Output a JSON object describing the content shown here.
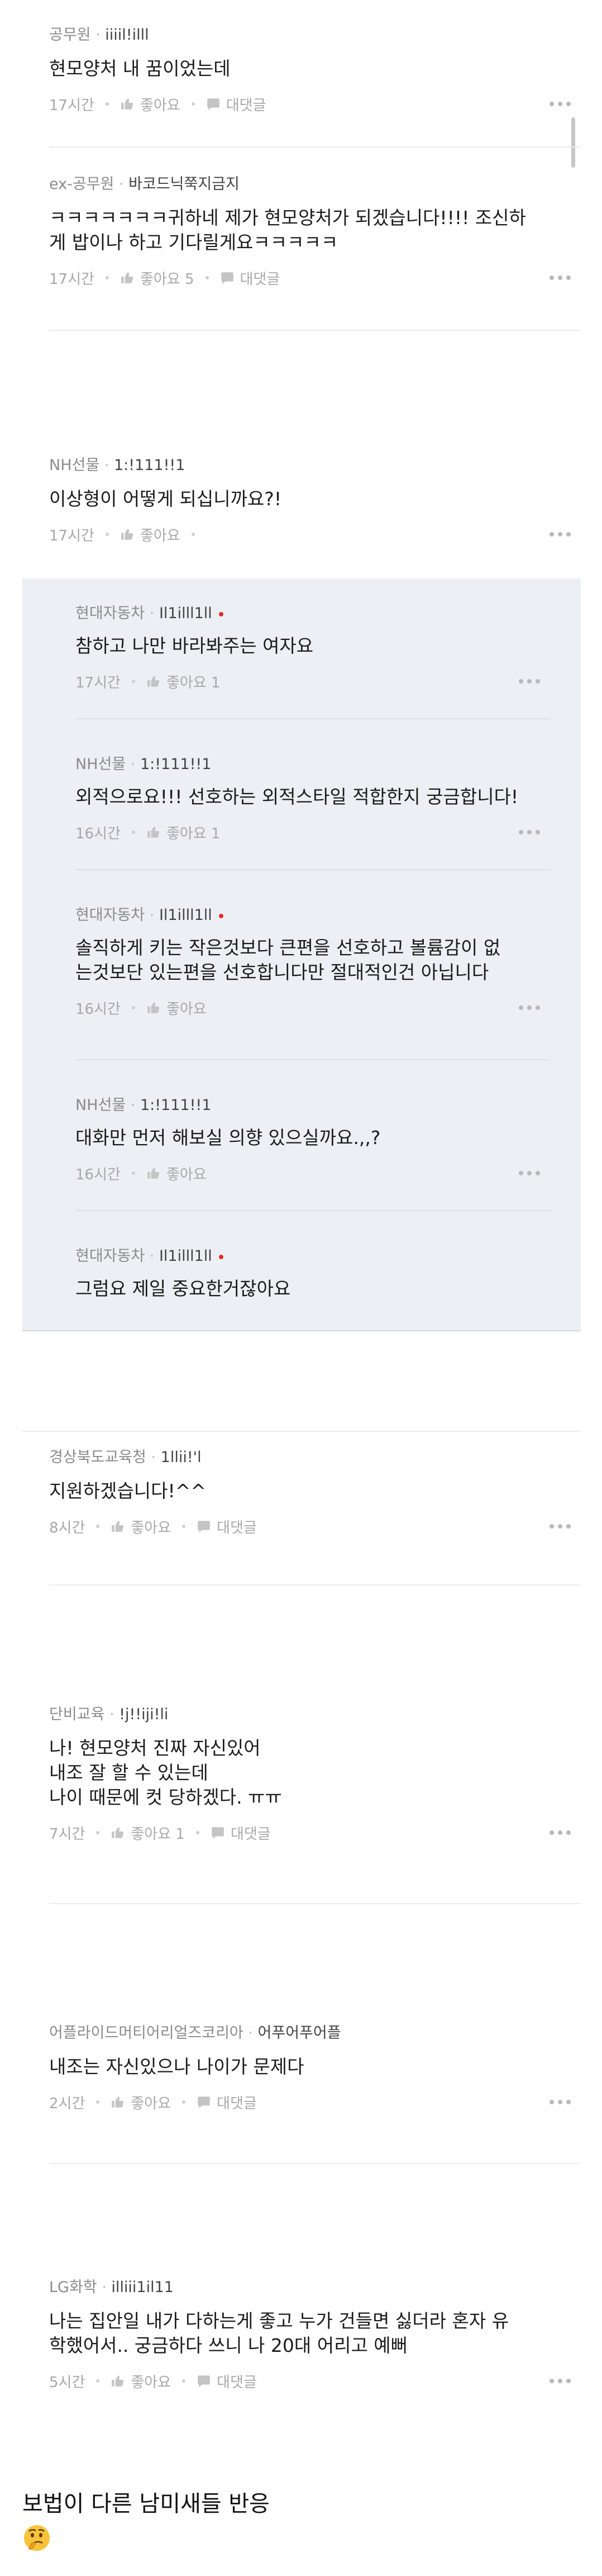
{
  "labels": {
    "like": "좋아요",
    "reply": "대댓글"
  },
  "comments": [
    {
      "company": "공무원",
      "nick": "iiiil!illl",
      "text": "현모양처 내 꿈이었는데",
      "time": "17시간",
      "like": "좋아요",
      "reply": "대댓글"
    },
    {
      "company": "ex-공무원",
      "nick": "바코드닉쭉지금지",
      "text": "ㅋㅋㅋㅋㅋㅋㅋ귀하네 제가 현모양처가 되겠습니다!!!! 조신하\n게 밥이나 하고 기다릴게요ㅋㅋㅋㅋㅋ",
      "time": "17시간",
      "like": "좋아요 5",
      "reply": "대댓글"
    },
    {
      "company": "NH선물",
      "nick": "1:!111!!1",
      "text": "이상형이 어떻게 되십니까요?!",
      "time": "17시간",
      "like": "좋아요"
    },
    {
      "company": "경상북도교육청",
      "nick": "1llii!'l",
      "text": "지원하겠습니다!^^",
      "time": "8시간",
      "like": "좋아요",
      "reply": "대댓글"
    },
    {
      "company": "단비교육",
      "nick": "!j!!iji!li",
      "text": "나! 현모양처 진짜 자신있어\n내조 잘 할 수 있는데\n나이 때문에 컷 당하겠다. ㅠㅠ",
      "time": "7시간",
      "like": "좋아요 1",
      "reply": "대댓글"
    },
    {
      "company": "어플라이드머티어리얼즈코리아",
      "nick": "어푸어푸어플",
      "text": "내조는 자신있으나 나이가 문제다",
      "time": "2시간",
      "like": "좋아요",
      "reply": "대댓글"
    },
    {
      "company": "LG화학",
      "nick": "illiii1il11",
      "text": "나는 집안일 내가 다하는게 좋고 누가 건들면 싫더라 혼자 유\n학했어서.. 궁금하다 쓰니 나 20대 어리고 예뻐",
      "time": "5시간",
      "like": "좋아요",
      "reply": "대댓글"
    }
  ],
  "replies": [
    {
      "company": "현대자동차",
      "nick": "Il1illl1ll",
      "author": true,
      "text": "참하고 나만 바라봐주는 여자요",
      "time": "17시간",
      "like": "좋아요 1"
    },
    {
      "company": "NH선물",
      "nick": "1:!111!!1",
      "author": false,
      "text": "외적으로요!!! 선호하는 외적스타일 적합한지 궁금합니다!",
      "time": "16시간",
      "like": "좋아요 1"
    },
    {
      "company": "현대자동차",
      "nick": "Il1illl1ll",
      "author": true,
      "text": "솔직하게 키는 작은것보다 큰편을 선호하고 볼륨감이 없\n는것보단 있는편을 선호합니다만 절대적인건 아닙니다",
      "time": "16시간",
      "like": "좋아요"
    },
    {
      "company": "NH선물",
      "nick": "1:!111!!1",
      "author": false,
      "text": "대화만 먼저 해보실 의향 있으실까요.,,?",
      "time": "16시간",
      "like": "좋아요"
    },
    {
      "company": "현대자동차",
      "nick": "Il1illl1ll",
      "author": true,
      "text": "그럼요 제일 중요한거잖아요"
    }
  ],
  "footer": {
    "title": "보법이 다른 남미새들 반응",
    "emoji": "thinking-face-emoji"
  }
}
